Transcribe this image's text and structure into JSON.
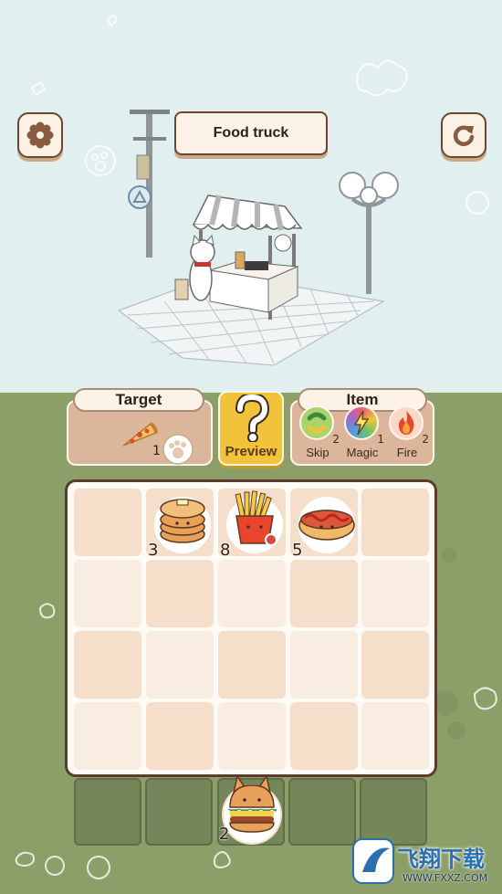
{
  "header": {
    "title": "Food truck",
    "settings_icon": "gear-icon",
    "restart_icon": "restart-icon"
  },
  "target": {
    "label": "Target",
    "item_icon": "pizza-icon",
    "count": "1"
  },
  "preview": {
    "label": "Preview",
    "icon": "question-mark-icon"
  },
  "items": {
    "label": "Item",
    "list": [
      {
        "name": "Skip",
        "count": "2",
        "icon": "skip-icon"
      },
      {
        "name": "Magic",
        "count": "1",
        "icon": "magic-icon"
      },
      {
        "name": "Fire",
        "count": "2",
        "icon": "fire-icon"
      }
    ]
  },
  "board": {
    "rows": 4,
    "cols": 5,
    "foods": [
      {
        "name": "pancake",
        "count": "3",
        "icon": "pancake-icon"
      },
      {
        "name": "fries",
        "count": "8",
        "icon": "fries-icon"
      },
      {
        "name": "hotdog",
        "count": "5",
        "icon": "hotdog-icon"
      }
    ]
  },
  "tray": {
    "slots": 5,
    "current": {
      "name": "burger",
      "count": "2",
      "icon": "burger-icon"
    }
  },
  "watermark": {
    "text": "飞翔下载",
    "url_text": "WWW.FXXZ.COM"
  },
  "colors": {
    "sky": "#e2efef",
    "grass": "#8d9f69",
    "panel": "#dcb69b",
    "preview": "#f0c33a",
    "border_dark": "#5c3b2a"
  }
}
